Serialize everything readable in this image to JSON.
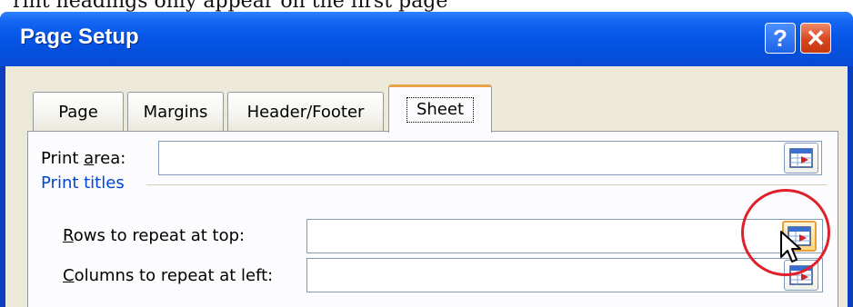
{
  "page_caption": "rint headings only appear on the first page",
  "window": {
    "title": "Page Setup",
    "help_label": "?",
    "close_label": "✕"
  },
  "tabs": [
    {
      "label": "Page",
      "active": false
    },
    {
      "label": "Margins",
      "active": false
    },
    {
      "label": "Header/Footer",
      "active": false
    },
    {
      "label": "Sheet",
      "active": true
    }
  ],
  "sheet": {
    "print_area": {
      "label_pre": "Print ",
      "label_key": "a",
      "label_post": "rea:",
      "value": ""
    },
    "print_titles_group": "Print titles",
    "rows_to_repeat": {
      "label_pre": "",
      "label_key": "R",
      "label_post": "ows to repeat at top:",
      "value": ""
    },
    "columns_to_repeat": {
      "label_pre": "",
      "label_key": "C",
      "label_post": "olumns to repeat at left:",
      "value": ""
    }
  },
  "icons": {
    "collapse_dialog": "collapse-dialog-icon",
    "cursor": "mouse-pointer-icon"
  },
  "colors": {
    "titlebar": "#0656e8",
    "dialog_bg": "#ece9d8",
    "group_title": "#0046d5",
    "highlight": "#e0202a",
    "active_tab_accent": "#e8a04a"
  }
}
